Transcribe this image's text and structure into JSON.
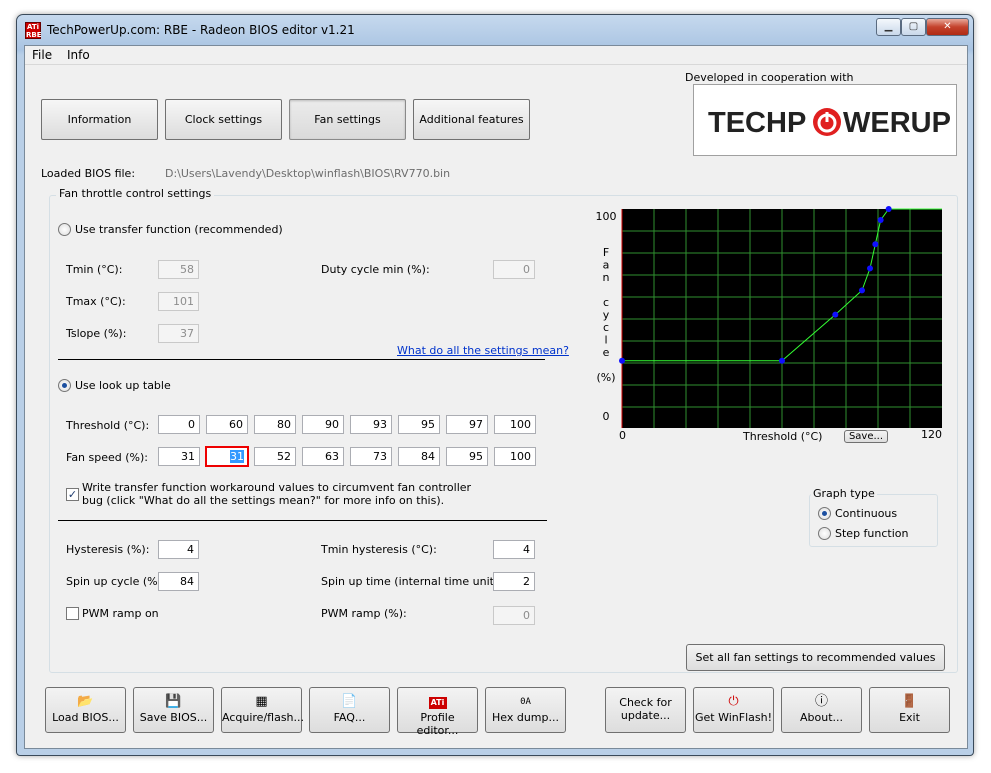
{
  "window": {
    "title": "TechPowerUp.com: RBE - Radeon BIOS editor v1.21",
    "icon": "ati-rbe-icon"
  },
  "menu": [
    "File",
    "Info"
  ],
  "tabs": [
    {
      "label": "Information",
      "active": false
    },
    {
      "label": "Clock settings",
      "active": false
    },
    {
      "label": "Fan settings",
      "active": true
    },
    {
      "label": "Additional features",
      "active": false
    }
  ],
  "cooperation": {
    "text": "Developed in cooperation with",
    "logo_left": "TECHP",
    "logo_right": "WERUP"
  },
  "bios": {
    "label": "Loaded BIOS file:",
    "path": "D:\\Users\\Lavendy\\Desktop\\winflash\\BIOS\\RV770.bin"
  },
  "fan": {
    "section_title": "Fan throttle control settings",
    "transfer_label": "Use transfer function (recommended)",
    "transfer_selected": false,
    "tmin_label": "Tmin (°C):",
    "tmin": "58",
    "tmax_label": "Tmax (°C):",
    "tmax": "101",
    "tslope_label": "Tslope (%):",
    "tslope": "37",
    "duty_label": "Duty cycle min (%):",
    "duty": "0",
    "help_link": "What do all the settings mean?",
    "lookup_label": "Use look up table",
    "lookup_selected": true,
    "threshold_label": "Threshold (°C):",
    "thresholds": [
      "0",
      "60",
      "80",
      "90",
      "93",
      "95",
      "97",
      "100"
    ],
    "speed_label": "Fan speed (%):",
    "speeds": [
      "31",
      "31",
      "52",
      "63",
      "73",
      "84",
      "95",
      "100"
    ],
    "workaround_line1": "Write transfer function workaround values to circumvent fan controller",
    "workaround_line2": "bug (click \"What do all the settings mean?\" for more info on this).",
    "workaround_checked": true,
    "hyst_label": "Hysteresis (%):",
    "hyst": "4",
    "tmin_hyst_label": "Tmin hysteresis (°C):",
    "tmin_hyst": "4",
    "spin_cycle_label": "Spin up cycle (%):",
    "spin_cycle": "84",
    "spin_time_label": "Spin up time (internal time units):",
    "spin_time": "2",
    "pwm_ramp_on_label": "PWM ramp on",
    "pwm_ramp_on": false,
    "pwm_ramp_label": "PWM ramp (%):",
    "pwm_ramp": "0",
    "recommend_button": "Set all fan settings to recommended values"
  },
  "chart_data": {
    "type": "line",
    "x": [
      0,
      60,
      80,
      90,
      93,
      95,
      97,
      100,
      120
    ],
    "y": [
      31,
      31,
      52,
      63,
      73,
      84,
      95,
      100,
      100
    ],
    "markers_x": [
      0,
      60,
      80,
      90,
      93,
      95,
      97,
      100
    ],
    "markers_y": [
      31,
      31,
      52,
      63,
      73,
      84,
      95,
      100
    ],
    "xlim": [
      0,
      120
    ],
    "ylim": [
      0,
      100
    ],
    "x_ticks": [
      "0",
      "120"
    ],
    "y_ticks": [
      "100",
      "0"
    ],
    "xlabel": "Threshold (°C)",
    "ylabel_letters": [
      "F",
      "a",
      "n",
      "",
      "c",
      "y",
      "c",
      "l",
      "e",
      "",
      "(%)"
    ],
    "grid": true,
    "colors": {
      "background": "#000000",
      "grid": "#2f8f2f",
      "line": "#33ff33",
      "marker": "#1010ff",
      "border": "#cc0000"
    },
    "save_label": "Save..."
  },
  "graph_type": {
    "title": "Graph type",
    "options": [
      {
        "label": "Continuous",
        "selected": true
      },
      {
        "label": "Step function",
        "selected": false
      }
    ]
  },
  "buttons": [
    {
      "label": "Load BIOS...",
      "icon": "folder-open-icon"
    },
    {
      "label": "Save BIOS...",
      "icon": "floppy-disk-icon"
    },
    {
      "label": "Acquire/flash...",
      "icon": "chip-icon"
    },
    {
      "label": "FAQ...",
      "icon": "document-icon"
    },
    {
      "label": "Profile editor...",
      "icon": "ati-logo-icon"
    },
    {
      "label": "Hex dump...",
      "icon": "hex-dump-icon"
    },
    {
      "label": "Check for update...",
      "icon": ""
    },
    {
      "label": "Get WinFlash!",
      "icon": "power-icon"
    },
    {
      "label": "About...",
      "icon": "info-icon"
    },
    {
      "label": "Exit",
      "icon": "exit-door-icon"
    }
  ]
}
